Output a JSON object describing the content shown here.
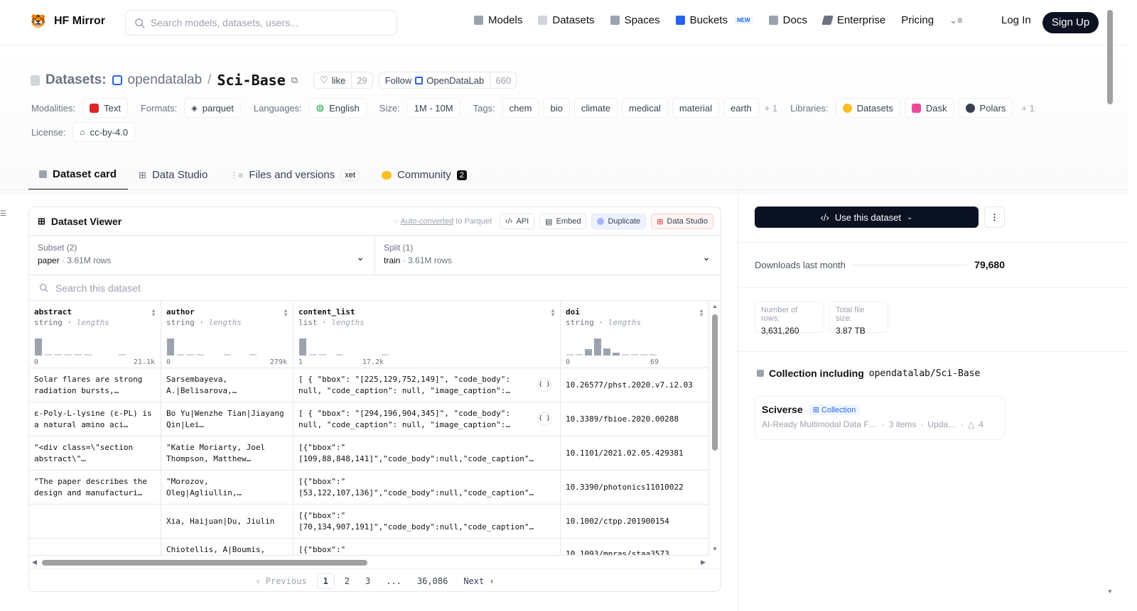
{
  "nav": {
    "brand": "HF Mirror",
    "search_placeholder": "Search models, datasets, users...",
    "links": [
      {
        "label": "Models",
        "color": "#9ca3af"
      },
      {
        "label": "Datasets",
        "color": "#d1d5db"
      },
      {
        "label": "Spaces",
        "color": "#9ca3af"
      },
      {
        "label": "Buckets",
        "color": "#2563eb"
      },
      {
        "label": "Docs",
        "color": "#9ca3af"
      },
      {
        "label": "Enterprise",
        "color": "#6b7280"
      }
    ],
    "buckets_badge": "NEW",
    "pricing": "Pricing",
    "login": "Log In",
    "signup": "Sign Up"
  },
  "header": {
    "section": "Datasets:",
    "org": "opendatalab",
    "sep": "/",
    "name": "Sci-Base",
    "like_label": "like",
    "like_count": "29",
    "follow_label": "Follow",
    "follow_org": "OpenDataLab",
    "follow_count": "660"
  },
  "tags": {
    "modalities_label": "Modalities:",
    "modality": "Text",
    "formats_label": "Formats:",
    "format": "parquet",
    "languages_label": "Languages:",
    "language": "English",
    "size_label": "Size:",
    "size": "1M - 10M",
    "tags_label": "Tags:",
    "tag_items": [
      "chem",
      "bio",
      "climate",
      "medical",
      "material",
      "earth"
    ],
    "tags_more": "+ 1",
    "libraries_label": "Libraries:",
    "libraries": [
      {
        "label": "Datasets",
        "color": "#fbbf24"
      },
      {
        "label": "Dask",
        "color": "#ec4899"
      },
      {
        "label": "Polars",
        "color": "#374151"
      }
    ],
    "libraries_more": "+ 1",
    "license_label": "License:",
    "license": "cc-by-4.0"
  },
  "tabs": [
    {
      "label": "Dataset card"
    },
    {
      "label": "Data Studio"
    },
    {
      "label": "Files and versions"
    },
    {
      "label": "Community"
    }
  ],
  "tabs_xet": "xet",
  "tabs_community_count": "2",
  "viewer": {
    "title": "Dataset Viewer",
    "auto_link": "Auto-converted",
    "auto_rest": " to Parquet",
    "btn_api": "API",
    "btn_embed": "Embed",
    "btn_duplicate": "Duplicate",
    "btn_studio": "Data Studio",
    "subset_label": "Subset (2)",
    "subset_value": "paper",
    "subset_rows": "3.61M rows",
    "split_label": "Split (1)",
    "split_value": "train",
    "split_rows": "3.61M rows",
    "search_placeholder": "Search this dataset",
    "dot": "·"
  },
  "columns": [
    {
      "name": "abstract",
      "type": "string",
      "kind": "lengths",
      "min": "0",
      "max": "21.1k"
    },
    {
      "name": "author",
      "type": "string",
      "kind": "lengths",
      "min": "0",
      "max": "279k"
    },
    {
      "name": "content_list",
      "type": "list",
      "kind": "lengths",
      "min": "1",
      "max": "17.2k"
    },
    {
      "name": "doi",
      "type": "string",
      "kind": "lengths",
      "min": "0",
      "max": "69"
    }
  ],
  "rows": [
    [
      "Solar flares are strong radiation bursts,…",
      "Sarsembayeva, A.|Belisarova,…",
      "[ { \"bbox\": \"[225,129,752,149]\", \"code_body\": null, \"code_caption\": null, \"image_caption\":…",
      "10.26577/phst.2020.v7.i2.03"
    ],
    [
      "ε-Poly-L-lysine (ε-PL) is a natural amino aci…",
      "Bo Yu|Wenzhe Tian|Jiayang Qin|Lei…",
      "[ { \"bbox\": \"[294,196,904,345]\", \"code_body\": null, \"code_caption\": null, \"image_caption\":…",
      "10.3389/fbioe.2020.00288"
    ],
    [
      "\"<div class=\\\"section abstract\\\"…",
      "\"Katie Moriarty, Joel Thompson, Matthew…",
      "[{\"bbox\":\"[109,88,848,141]\",\"code_body\":null,\"code_caption\"…",
      "10.1101/2021.02.05.429381"
    ],
    [
      "\"The paper describes the design and manufacturi…",
      "\"Morozov, Oleg|Agliullin,…",
      "[{\"bbox\":\"[53,122,107,136]\",\"code_body\":null,\"code_caption\"…",
      "10.3390/photonics11010022"
    ],
    [
      "",
      "Xia, Haijuan|Du, Jiulin",
      "[{\"bbox\":\"[70,134,907,191]\",\"code_body\":null,\"code_caption\"…",
      "10.1002/ctpp.201900154"
    ],
    [
      "",
      "Chiotellis, A|Boumis,",
      "[{\"bbox\":\"",
      "10.1093/mnras/staa3573"
    ]
  ],
  "json_icon_label": "{ }",
  "pager": {
    "prev": "‹ Previous",
    "pages": [
      "1",
      "2",
      "3",
      "...",
      "36,086"
    ],
    "next": "Next ›"
  },
  "panel": {
    "use_label": "Use this dataset",
    "downloads_label": "Downloads last month",
    "downloads": "79,680",
    "rows_label": "Number of rows:",
    "rows_value": "3,631,260",
    "size_label": "Total file size:",
    "size_value": "3.87 TB",
    "collection_label": "Collection including",
    "collection_repo": "opendatalab/Sci-Base",
    "card_title": "Sciverse",
    "card_badge": "Collection",
    "card_desc": "AI-Ready Multimodal Data F…",
    "card_items": "3 items",
    "card_updated": "Upda…",
    "card_likes": "4"
  }
}
